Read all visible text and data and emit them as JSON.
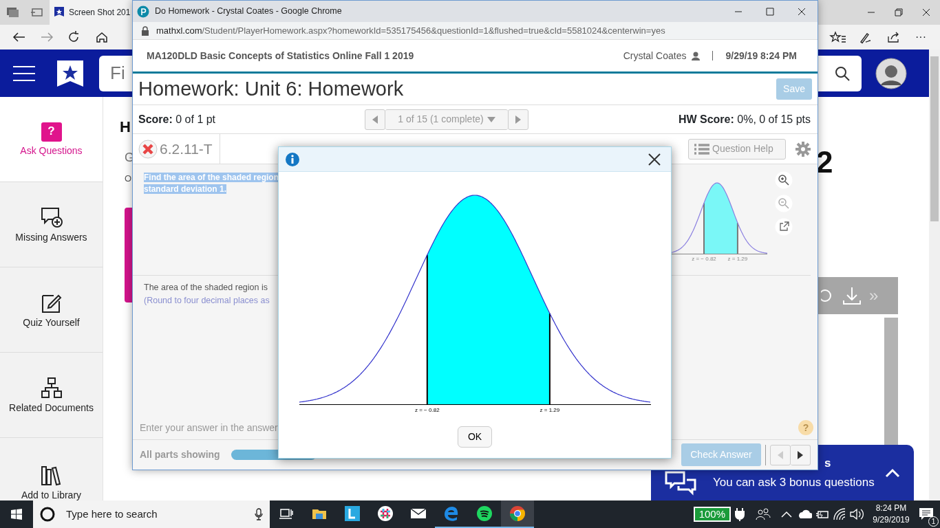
{
  "edge_browser": {
    "tab": {
      "label": "Screen Shot 201",
      "selected": true
    },
    "more_glyph": "···",
    "search": {
      "placeholder": "Fi"
    },
    "sidebar": [
      {
        "label": "Ask Questions",
        "selected": true,
        "kind": "ask"
      },
      {
        "label": "Missing Answers",
        "selected": false,
        "kind": "missing"
      },
      {
        "label": "Quiz Yourself",
        "selected": false,
        "kind": "quiz"
      },
      {
        "label": "Related Documents",
        "selected": false,
        "kind": "related"
      },
      {
        "label": "Add to Library",
        "selected": false,
        "kind": "library"
      }
    ],
    "ask_badge": "?",
    "page_heading": "H",
    "page_subtext": "G",
    "page_text": "O",
    "big_digit": "2",
    "toolbar_glyph": "»",
    "chat_banner": {
      "title": "s",
      "text": "You can ask 3 bonus questions"
    }
  },
  "chrome_window": {
    "title": "Do Homework - Crystal Coates - Google Chrome",
    "url_host": "mathxl.com",
    "url_path": "/Student/PlayerHomework.aspx?homeworkId=535175456&questionId=1&flushed=true&cId=5581024&centerwin=yes",
    "course": "MA120DLD Basic Concepts of Statistics Online Fall 1 2019",
    "user": "Crystal Coates",
    "datetime": "9/29/19 8:24 PM",
    "homework_title": "Homework: Unit 6: Homework",
    "save": {
      "label": "Save",
      "disabled": true
    },
    "score": "**Score:** 0 of 1 pt",
    "question_nav": "1 of 15 (1 complete)",
    "hw_score": "**HW Score:** 0%, 0 of 15 pts",
    "question_id": "6.2.11-T",
    "question_help": "Question Help",
    "question_text": [
      "Find the area of the shaded region",
      "standard deviation 1."
    ],
    "thumbnail_labels": [
      "z = − 0.82",
      "z = 1.29"
    ],
    "answer_prompt": "The area of the shaded region is",
    "answer_note": "(Round to four decimal places as",
    "hint": "Enter your answer in the answer",
    "help_glyph": "?",
    "parts_label": "All parts showing",
    "check_answer": {
      "label": "Check Answer",
      "disabled": true
    }
  },
  "modal": {
    "labels": [
      "z = − 0.82",
      "z = 1.29"
    ],
    "ok": "OK"
  },
  "taskbar": {
    "search_placeholder": "Type here to search",
    "apps": [
      {
        "kind": "taskview",
        "running": false,
        "active": false
      },
      {
        "kind": "explorer",
        "running": false,
        "active": false
      },
      {
        "kind": "lapp",
        "running": false,
        "active": false
      },
      {
        "kind": "slack",
        "running": false,
        "active": false
      },
      {
        "kind": "mail",
        "running": false,
        "active": false
      },
      {
        "kind": "edge",
        "running": true,
        "active": false
      },
      {
        "kind": "spotify",
        "running": true,
        "active": false
      },
      {
        "kind": "chrome",
        "running": true,
        "active": true
      }
    ],
    "battery": "100%",
    "time": "8:24 PM",
    "date": "9/29/2019",
    "notifications": "1"
  }
}
